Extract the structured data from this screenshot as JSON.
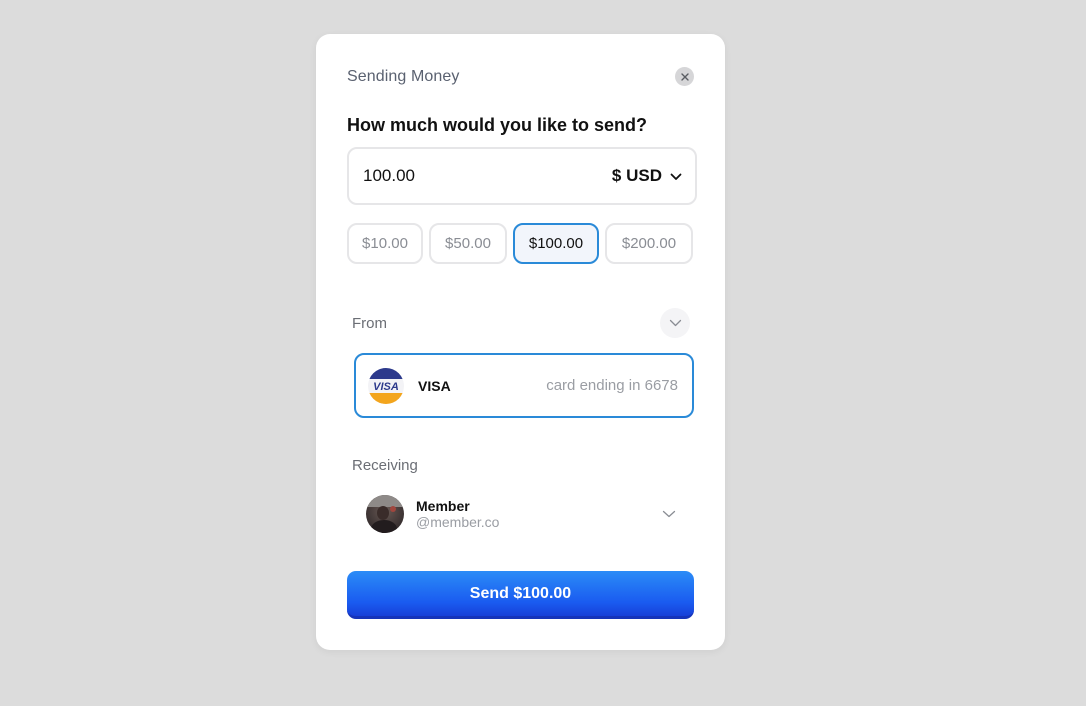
{
  "dialog": {
    "title": "Sending Money",
    "close_icon": "close-icon"
  },
  "amount": {
    "question": "How much would you like to send?",
    "value": "100.00",
    "currency_label": "$ USD"
  },
  "presets": [
    {
      "label": "$10.00",
      "selected": false
    },
    {
      "label": "$50.00",
      "selected": false
    },
    {
      "label": "$100.00",
      "selected": true
    },
    {
      "label": "$200.00",
      "selected": false
    }
  ],
  "from": {
    "label": "From",
    "card_brand": "VISA",
    "card_logo_text": "VISA",
    "card_ending": "card ending in 6678"
  },
  "receiving": {
    "label": "Receiving",
    "name": "Member",
    "handle": "@member.co"
  },
  "send_button": {
    "label": "Send $100.00"
  },
  "colors": {
    "accent": "#2a8ad8",
    "button_top": "#2b8cf7",
    "button_bottom": "#1740d8",
    "background": "#dcdcdc"
  }
}
